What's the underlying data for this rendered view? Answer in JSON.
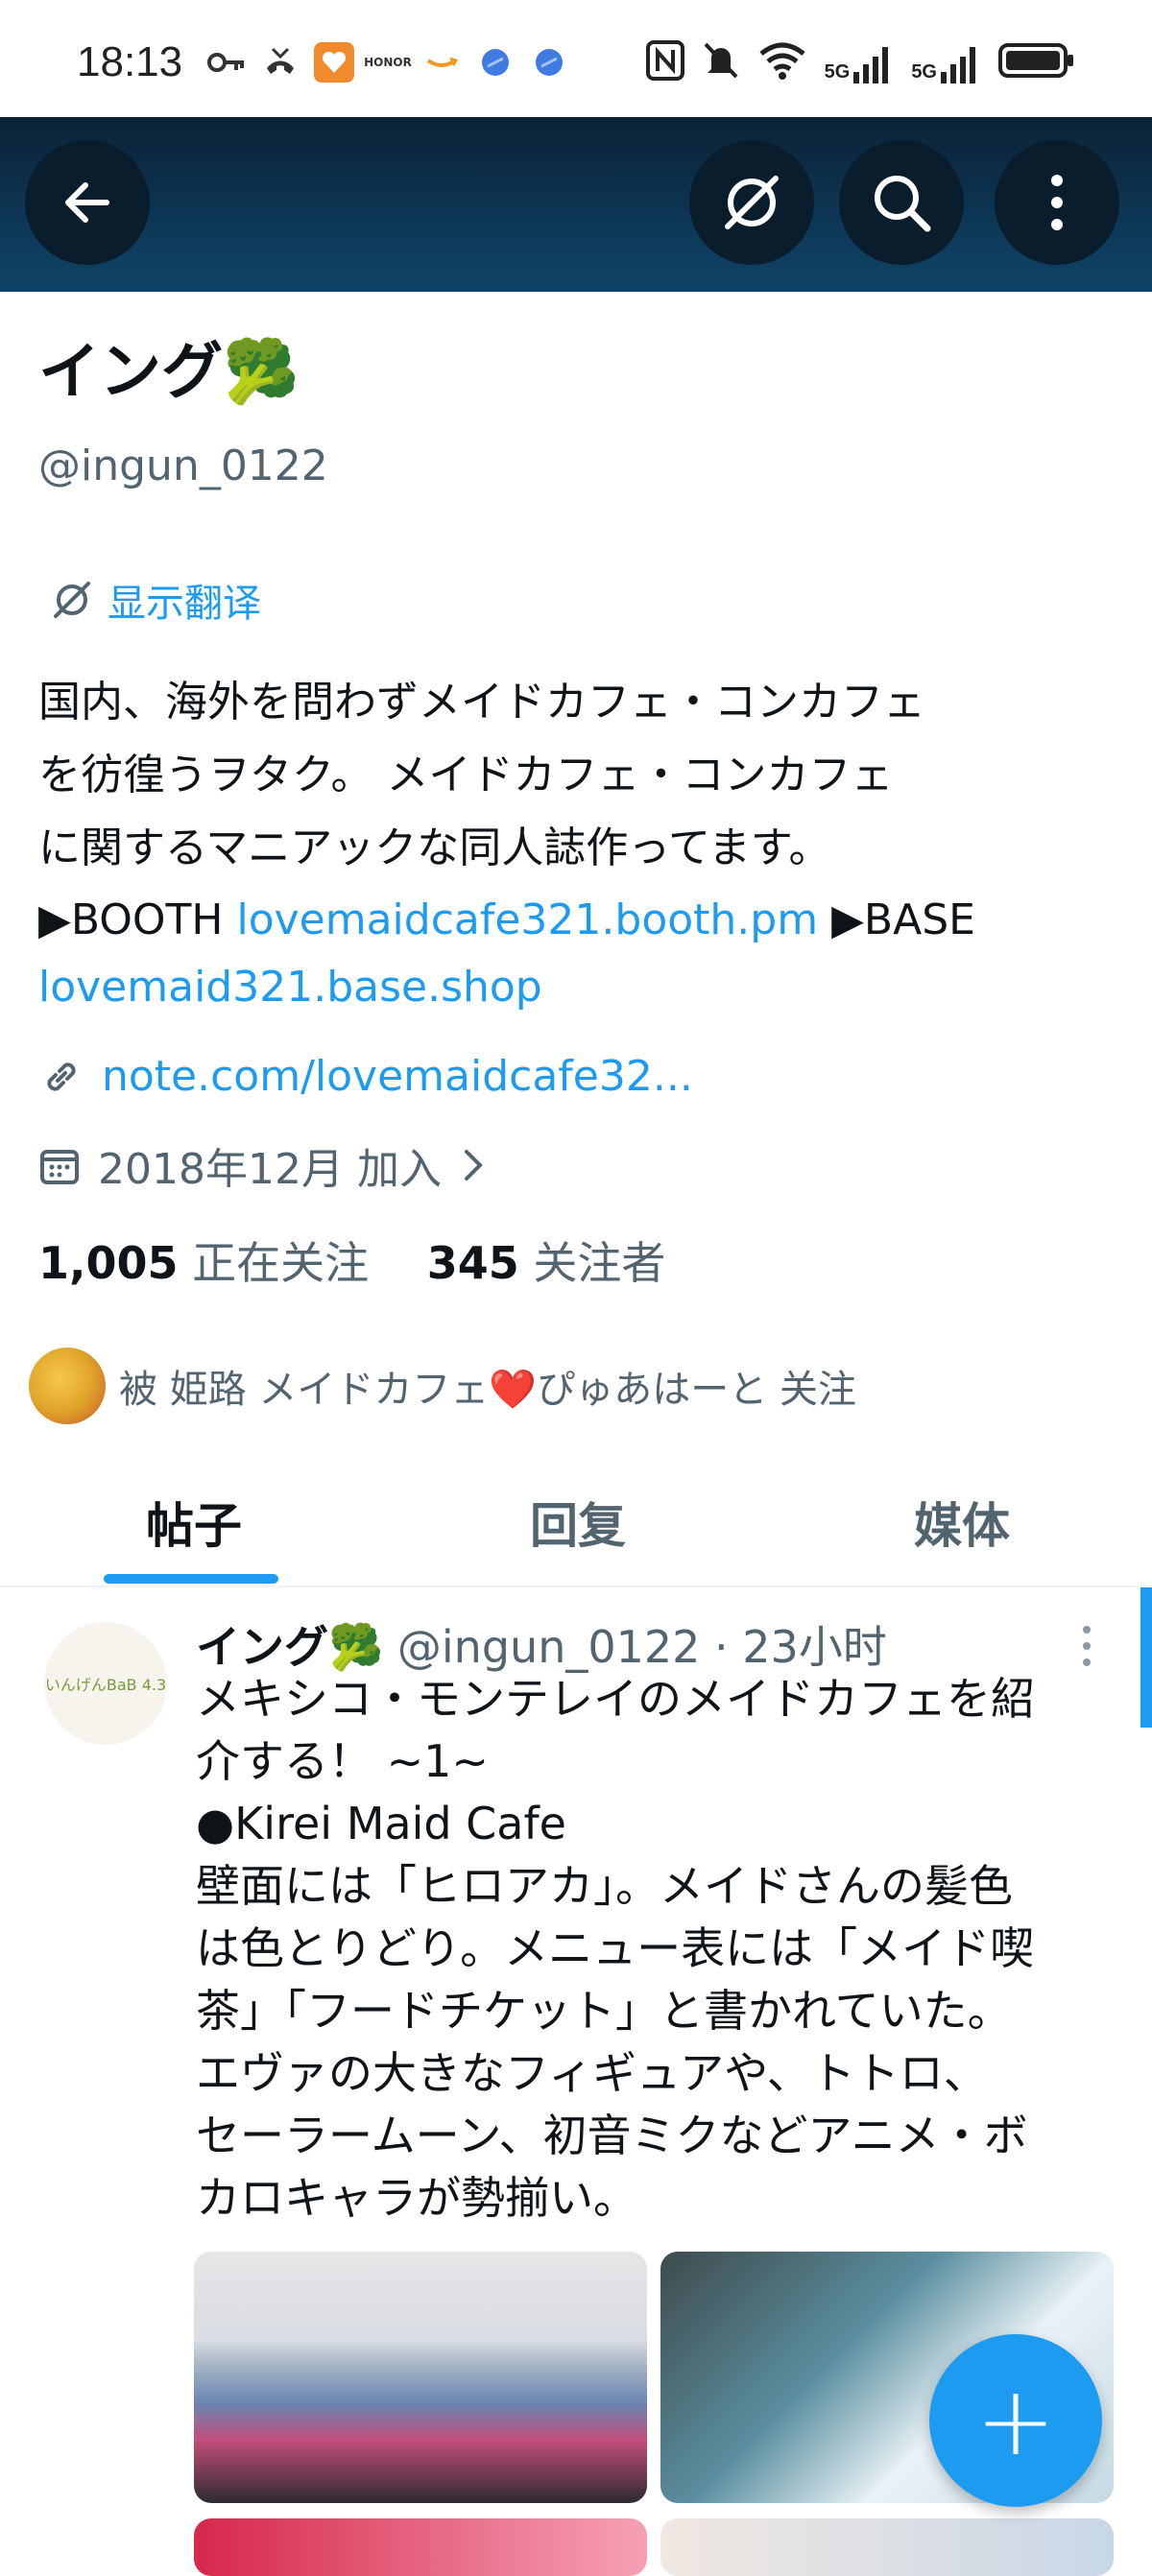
{
  "status_bar": {
    "time": "18:13",
    "left_icons": [
      "key-icon",
      "missed-call-icon",
      "heart-app-icon",
      "honor-icon",
      "amazon-icon",
      "blue-ball-icon",
      "blue-ball-icon"
    ],
    "right_icons": [
      "nfc-icon",
      "mute-icon",
      "wifi-icon",
      "5g-signal-icon",
      "5g-signal-icon",
      "battery-icon"
    ],
    "network_label": "5G"
  },
  "header": {
    "back_icon": "arrow-left-icon",
    "actions": [
      "translate-off-icon",
      "search-icon",
      "more-vertical-icon"
    ]
  },
  "profile": {
    "name": "イング🥦",
    "handle": "@ingun_0122",
    "translate_label": "显示翻译",
    "bio_lines": [
      "国内、海外を問わずメイドカフェ・コンカフェ",
      "を彷徨うヲタク。 メイドカフェ・コンカフェ",
      "に関するマニアックな同人誌作ってます。"
    ],
    "booth_prefix": "▶BOOTH ",
    "booth_link": "lovemaidcafe321.booth.pm",
    "base_prefix": " ▶BASE",
    "base_link": "lovemaid321.base.shop",
    "website": "note.com/lovemaidcafe32...",
    "joined": "2018年12月 加入",
    "following_count": "1,005",
    "following_label": "正在关注",
    "followers_count": "345",
    "followers_label": "关注者",
    "followed_by_text": "被 姫路 メイドカフェ❤️ぴゅあはーと 关注"
  },
  "tabs": [
    {
      "label": "帖子",
      "active": true
    },
    {
      "label": "回复",
      "active": false
    },
    {
      "label": "媒体",
      "active": false
    }
  ],
  "post": {
    "author": "イング🥦",
    "handle": "@ingun_0122",
    "time": "· 23小时",
    "avatar_caption": "いんげんBaB 4.3",
    "lines": [
      "メキシコ・モンテレイのメイドカフェを紹",
      "介する！ ~1~",
      "●Kirei Maid Cafe",
      "壁面には「ヒロアカ」。メイドさんの髪色",
      "は色とりどり。メニュー表には「メイド喫",
      "茶」「フードチケット」と書かれていた。",
      "エヴァの大きなフィギュアや、トトロ、",
      "セーラームーン、初音ミクなどアニメ・ボ",
      "カロキャラが勢揃い。"
    ]
  },
  "fab_label": "+",
  "colors": {
    "accent": "#1d9bf0",
    "banner": "#0d3756",
    "secondary_text": "#536471"
  }
}
